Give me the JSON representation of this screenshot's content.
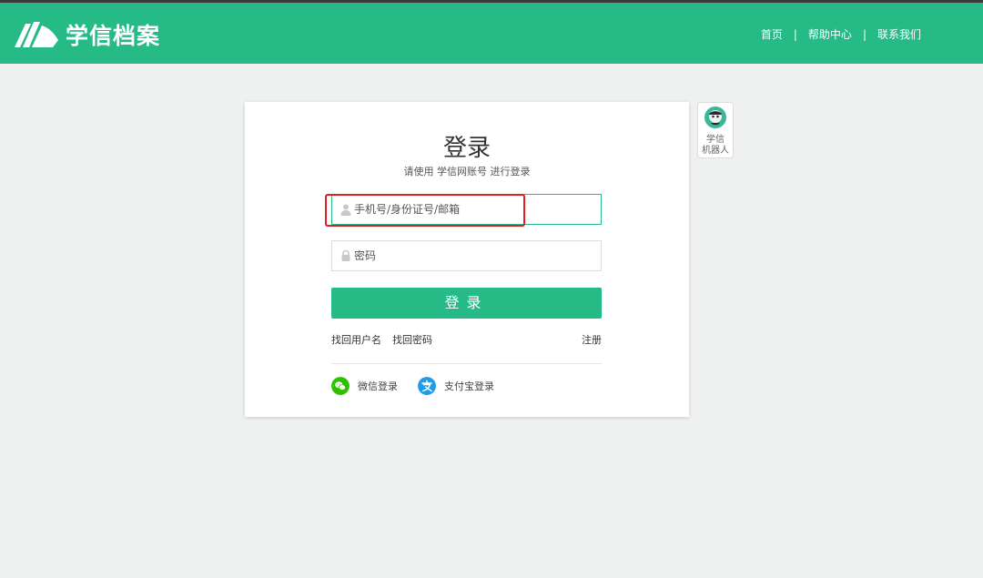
{
  "header": {
    "logo_text": "学信档案",
    "nav": [
      "首页",
      "帮助中心",
      "联系我们"
    ],
    "separator": "|"
  },
  "login": {
    "title": "登录",
    "subtitle": "请使用 学信网账号 进行登录",
    "username_placeholder": "手机号/身份证号/邮箱",
    "password_placeholder": "密码",
    "submit_label": "登录",
    "find_username": "找回用户名",
    "find_password": "找回密码",
    "register": "注册",
    "wechat_login": "微信登录",
    "alipay_login": "支付宝登录"
  },
  "robot": {
    "line1": "学信",
    "line2": "机器人"
  },
  "icons": {
    "logo": "book-pages-icon",
    "user": "user-icon",
    "lock": "lock-icon",
    "wechat": "wechat-icon",
    "alipay": "alipay-icon",
    "robot": "robot-avatar-icon"
  },
  "colors": {
    "brand": "#26ba87",
    "wechat": "#2dc100",
    "alipay": "#1e9ce8",
    "highlight": "#e02020"
  }
}
